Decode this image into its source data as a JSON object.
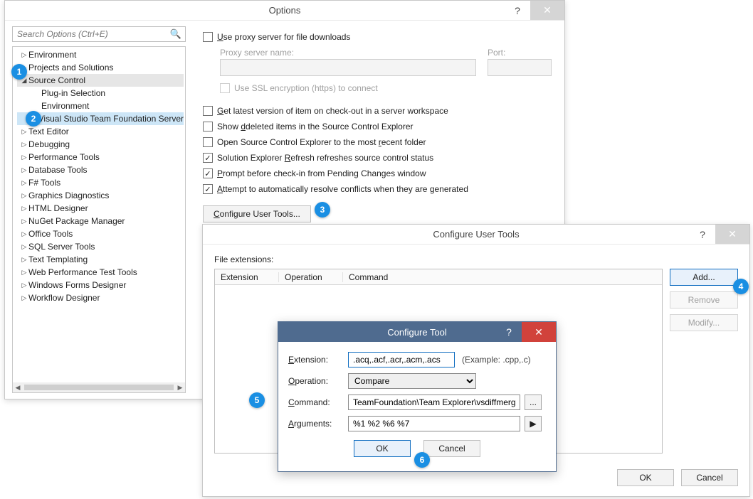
{
  "options": {
    "title": "Options",
    "searchPlaceholder": "Search Options (Ctrl+E)",
    "tree": [
      {
        "label": "Environment",
        "depth": 1,
        "expandable": true,
        "expanded": false
      },
      {
        "label": "Projects and Solutions",
        "depth": 1,
        "expandable": true,
        "expanded": false
      },
      {
        "label": "Source Control",
        "depth": 1,
        "expandable": true,
        "expanded": true,
        "cls": "sel-parent"
      },
      {
        "label": "Plug-in Selection",
        "depth": 2,
        "expandable": false
      },
      {
        "label": "Environment",
        "depth": 2,
        "expandable": false
      },
      {
        "label": "Visual Studio Team Foundation Server",
        "depth": 2,
        "expandable": false,
        "cls": "sel"
      },
      {
        "label": "Text Editor",
        "depth": 1,
        "expandable": true,
        "expanded": false
      },
      {
        "label": "Debugging",
        "depth": 1,
        "expandable": true,
        "expanded": false
      },
      {
        "label": "Performance Tools",
        "depth": 1,
        "expandable": true,
        "expanded": false
      },
      {
        "label": "Database Tools",
        "depth": 1,
        "expandable": true,
        "expanded": false
      },
      {
        "label": "F# Tools",
        "depth": 1,
        "expandable": true,
        "expanded": false
      },
      {
        "label": "Graphics Diagnostics",
        "depth": 1,
        "expandable": true,
        "expanded": false
      },
      {
        "label": "HTML Designer",
        "depth": 1,
        "expandable": true,
        "expanded": false
      },
      {
        "label": "NuGet Package Manager",
        "depth": 1,
        "expandable": true,
        "expanded": false
      },
      {
        "label": "Office Tools",
        "depth": 1,
        "expandable": true,
        "expanded": false
      },
      {
        "label": "SQL Server Tools",
        "depth": 1,
        "expandable": true,
        "expanded": false
      },
      {
        "label": "Text Templating",
        "depth": 1,
        "expandable": true,
        "expanded": false
      },
      {
        "label": "Web Performance Test Tools",
        "depth": 1,
        "expandable": true,
        "expanded": false
      },
      {
        "label": "Windows Forms Designer",
        "depth": 1,
        "expandable": true,
        "expanded": false
      },
      {
        "label": "Workflow Designer",
        "depth": 1,
        "expandable": true,
        "expanded": false
      }
    ],
    "proxy": {
      "useProxy": "Use proxy server for file downloads",
      "serverLabel": "Proxy server name:",
      "portLabel": "Port:",
      "ssl": "Use SSL encryption (https) to connect"
    },
    "checks": [
      {
        "checked": false,
        "pre": "G",
        "rest": "et latest version of item on check-out in a server workspace"
      },
      {
        "checked": false,
        "pre": "Show ",
        "rest": "deleted items in the Source Control Explorer",
        "uword": "d"
      },
      {
        "checked": false,
        "pre": "Open Source Control Explorer to the most ",
        "rest": "ecent folder",
        "uword": "r"
      },
      {
        "checked": true,
        "pre": "Solution Explorer ",
        "rest": "efresh refreshes source control status",
        "uword": "R"
      },
      {
        "checked": true,
        "pre": "",
        "rest": "rompt before check-in from Pending Changes window",
        "uword": "P"
      },
      {
        "checked": true,
        "pre": "",
        "rest": "ttempt to automatically resolve conflicts when they are generated",
        "uword": "A"
      }
    ],
    "configureBtn": "Configure User Tools..."
  },
  "cut": {
    "title": "Configure User Tools",
    "fileExtLabel": "File extensions:",
    "cols": {
      "c1": "Extension",
      "c2": "Operation",
      "c3": "Command"
    },
    "sideButtons": {
      "add": "Add...",
      "remove": "Remove",
      "modify": "Modify..."
    },
    "ok": "OK",
    "cancel": "Cancel"
  },
  "ct": {
    "title": "Configure Tool",
    "labels": {
      "ext": "Extension:",
      "op": "Operation:",
      "cmd": "Command:",
      "args": "Arguments:"
    },
    "extValue": ".acq,.acf,.acr,.acm,.acs",
    "extNote": "(Example: .cpp,.c)",
    "opValue": "Compare",
    "cmdValue": "TeamFoundation\\Team Explorer\\vsdiffmerge.exe",
    "argsValue": "%1 %2 %6 %7",
    "ok": "OK",
    "cancel": "Cancel"
  },
  "badges": [
    "1",
    "2",
    "3",
    "4",
    "5",
    "6"
  ]
}
